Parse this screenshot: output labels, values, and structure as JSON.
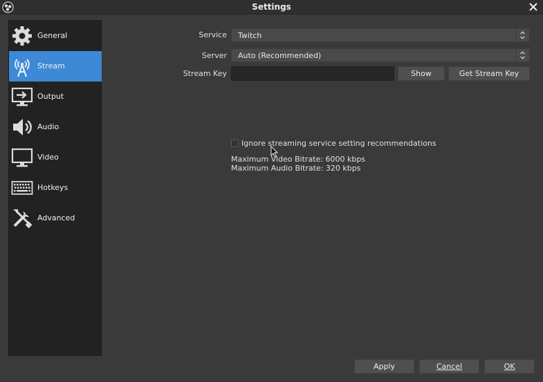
{
  "window": {
    "title": "Settings"
  },
  "sidebar": {
    "items": [
      {
        "label": "General",
        "icon": "gear-icon",
        "active": false
      },
      {
        "label": "Stream",
        "icon": "antenna-icon",
        "active": true
      },
      {
        "label": "Output",
        "icon": "output-monitor-icon",
        "active": false
      },
      {
        "label": "Audio",
        "icon": "speaker-icon",
        "active": false
      },
      {
        "label": "Video",
        "icon": "monitor-icon",
        "active": false
      },
      {
        "label": "Hotkeys",
        "icon": "keyboard-icon",
        "active": false
      },
      {
        "label": "Advanced",
        "icon": "tools-icon",
        "active": false
      }
    ]
  },
  "stream": {
    "service_label": "Service",
    "service_value": "Twitch",
    "server_label": "Server",
    "server_value": "Auto (Recommended)",
    "key_label": "Stream Key",
    "key_value": "",
    "show_button": "Show",
    "get_key_button": "Get Stream Key",
    "ignore_checkbox_label": "Ignore streaming service setting recommendations",
    "ignore_checked": false,
    "max_video_bitrate": "Maximum Video Bitrate: 6000 kbps",
    "max_audio_bitrate": "Maximum Audio Bitrate: 320 kbps"
  },
  "footer": {
    "apply": "Apply",
    "cancel": "Cancel",
    "ok": "OK"
  },
  "colors": {
    "accent": "#3d89d6",
    "background": "#3a3a3a",
    "sidebar": "#222222"
  }
}
